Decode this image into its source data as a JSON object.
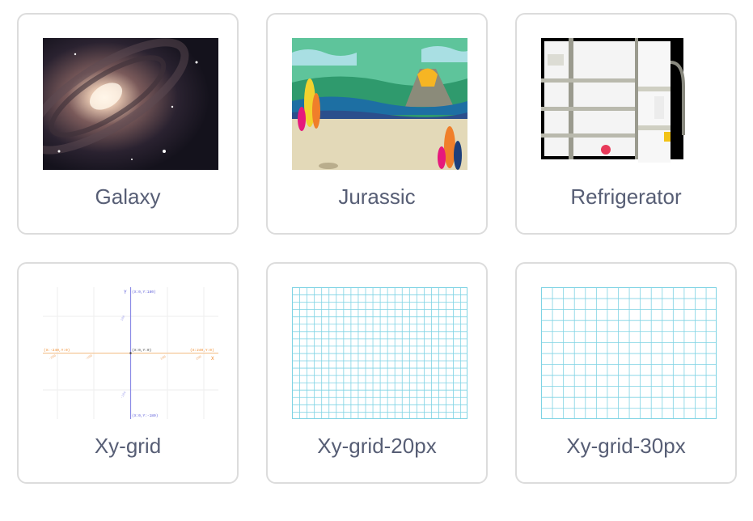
{
  "backdrops": [
    {
      "name": "Galaxy",
      "image": "galaxy-image"
    },
    {
      "name": "Jurassic",
      "image": "jurassic-image"
    },
    {
      "name": "Refrigerator",
      "image": "refrigerator-image"
    },
    {
      "name": "Xy-grid",
      "image": "xy-grid-image"
    },
    {
      "name": "Xy-grid-20px",
      "image": "grid-20px-image"
    },
    {
      "name": "Xy-grid-30px",
      "image": "grid-30px-image"
    }
  ],
  "xy_grid": {
    "axis_x": "X",
    "axis_y": "Y",
    "coord_top": "(X:0,Y:180)",
    "coord_bottom": "(X:0,Y:-180)",
    "coord_left": "(X:-240,Y:0)",
    "coord_right": "(X:240,Y:0)",
    "coord_center": "(X:0,Y:0)",
    "tick_x_neg200": "-200",
    "tick_x_neg100": "-100",
    "tick_x_100": "100",
    "tick_x_200": "200",
    "tick_y_100": "100",
    "tick_y_neg100": "-100"
  },
  "colors": {
    "card_border": "#dcdcdc",
    "label_text": "#575e75",
    "grid_line": "#7fd3e4"
  }
}
